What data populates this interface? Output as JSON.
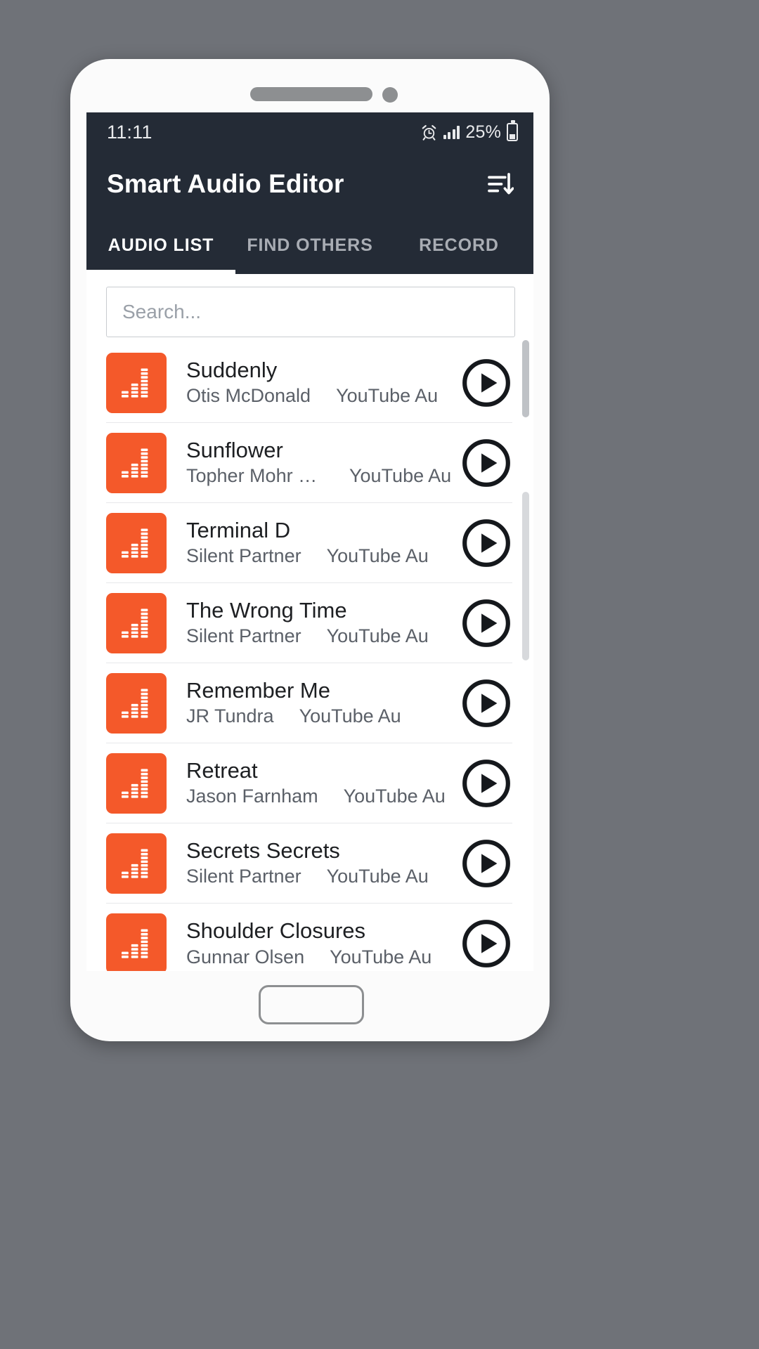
{
  "statusbar": {
    "time": "11:11",
    "alarm_icon": "alarm-clock-icon",
    "signal_icon": "signal-bars-icon",
    "battery_percent": "25%",
    "battery_icon": "battery-icon"
  },
  "appbar": {
    "title": "Smart Audio Editor",
    "sort_icon": "sort-descending-icon"
  },
  "tabs": [
    {
      "label": "AUDIO LIST",
      "active": true
    },
    {
      "label": "FIND OTHERS",
      "active": false
    },
    {
      "label": "RECORD",
      "active": false
    }
  ],
  "search": {
    "value": "",
    "placeholder": "Search..."
  },
  "colors": {
    "accent_orange": "#f4592a",
    "appbar_dark": "#242b36",
    "title_text": "#1d1f22",
    "subtitle_text": "#5b6068",
    "tab_inactive": "#a9adb4"
  },
  "list": {
    "thumb_icon": "equalizer-icon",
    "play_icon": "play-circle-icon",
    "items": [
      {
        "title": "Suddenly",
        "artist": "Otis McDonald",
        "source": "YouTube Au"
      },
      {
        "title": "Sunflower",
        "artist": "Topher Mohr a...",
        "source": "YouTube Au"
      },
      {
        "title": "Terminal D",
        "artist": "Silent Partner",
        "source": "YouTube Au"
      },
      {
        "title": "The Wrong Time",
        "artist": "Silent Partner",
        "source": "YouTube Au"
      },
      {
        "title": "Remember Me",
        "artist": "JR Tundra",
        "source": "YouTube Au"
      },
      {
        "title": "Retreat",
        "artist": "Jason Farnham",
        "source": "YouTube Au"
      },
      {
        "title": "Secrets Secrets",
        "artist": "Silent Partner",
        "source": "YouTube Au"
      },
      {
        "title": "Shoulder Closures",
        "artist": "Gunnar Olsen",
        "source": "YouTube Au"
      }
    ]
  }
}
